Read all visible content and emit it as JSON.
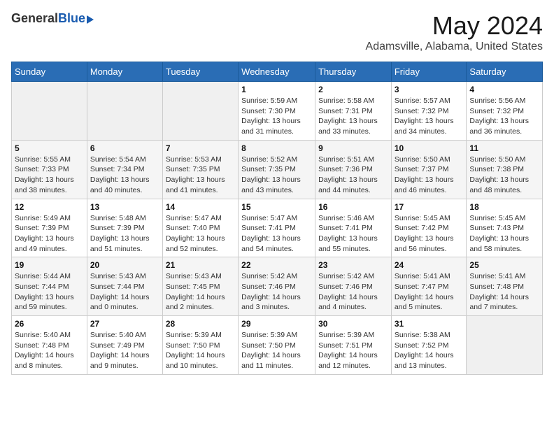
{
  "header": {
    "logo_general": "General",
    "logo_blue": "Blue",
    "title": "May 2024",
    "subtitle": "Adamsville, Alabama, United States"
  },
  "days_of_week": [
    "Sunday",
    "Monday",
    "Tuesday",
    "Wednesday",
    "Thursday",
    "Friday",
    "Saturday"
  ],
  "weeks": [
    {
      "days": [
        {
          "number": "",
          "info": ""
        },
        {
          "number": "",
          "info": ""
        },
        {
          "number": "",
          "info": ""
        },
        {
          "number": "1",
          "info": "Sunrise: 5:59 AM\nSunset: 7:30 PM\nDaylight: 13 hours and 31 minutes."
        },
        {
          "number": "2",
          "info": "Sunrise: 5:58 AM\nSunset: 7:31 PM\nDaylight: 13 hours and 33 minutes."
        },
        {
          "number": "3",
          "info": "Sunrise: 5:57 AM\nSunset: 7:32 PM\nDaylight: 13 hours and 34 minutes."
        },
        {
          "number": "4",
          "info": "Sunrise: 5:56 AM\nSunset: 7:32 PM\nDaylight: 13 hours and 36 minutes."
        }
      ]
    },
    {
      "days": [
        {
          "number": "5",
          "info": "Sunrise: 5:55 AM\nSunset: 7:33 PM\nDaylight: 13 hours and 38 minutes."
        },
        {
          "number": "6",
          "info": "Sunrise: 5:54 AM\nSunset: 7:34 PM\nDaylight: 13 hours and 40 minutes."
        },
        {
          "number": "7",
          "info": "Sunrise: 5:53 AM\nSunset: 7:35 PM\nDaylight: 13 hours and 41 minutes."
        },
        {
          "number": "8",
          "info": "Sunrise: 5:52 AM\nSunset: 7:35 PM\nDaylight: 13 hours and 43 minutes."
        },
        {
          "number": "9",
          "info": "Sunrise: 5:51 AM\nSunset: 7:36 PM\nDaylight: 13 hours and 44 minutes."
        },
        {
          "number": "10",
          "info": "Sunrise: 5:50 AM\nSunset: 7:37 PM\nDaylight: 13 hours and 46 minutes."
        },
        {
          "number": "11",
          "info": "Sunrise: 5:50 AM\nSunset: 7:38 PM\nDaylight: 13 hours and 48 minutes."
        }
      ]
    },
    {
      "days": [
        {
          "number": "12",
          "info": "Sunrise: 5:49 AM\nSunset: 7:39 PM\nDaylight: 13 hours and 49 minutes."
        },
        {
          "number": "13",
          "info": "Sunrise: 5:48 AM\nSunset: 7:39 PM\nDaylight: 13 hours and 51 minutes."
        },
        {
          "number": "14",
          "info": "Sunrise: 5:47 AM\nSunset: 7:40 PM\nDaylight: 13 hours and 52 minutes."
        },
        {
          "number": "15",
          "info": "Sunrise: 5:47 AM\nSunset: 7:41 PM\nDaylight: 13 hours and 54 minutes."
        },
        {
          "number": "16",
          "info": "Sunrise: 5:46 AM\nSunset: 7:41 PM\nDaylight: 13 hours and 55 minutes."
        },
        {
          "number": "17",
          "info": "Sunrise: 5:45 AM\nSunset: 7:42 PM\nDaylight: 13 hours and 56 minutes."
        },
        {
          "number": "18",
          "info": "Sunrise: 5:45 AM\nSunset: 7:43 PM\nDaylight: 13 hours and 58 minutes."
        }
      ]
    },
    {
      "days": [
        {
          "number": "19",
          "info": "Sunrise: 5:44 AM\nSunset: 7:44 PM\nDaylight: 13 hours and 59 minutes."
        },
        {
          "number": "20",
          "info": "Sunrise: 5:43 AM\nSunset: 7:44 PM\nDaylight: 14 hours and 0 minutes."
        },
        {
          "number": "21",
          "info": "Sunrise: 5:43 AM\nSunset: 7:45 PM\nDaylight: 14 hours and 2 minutes."
        },
        {
          "number": "22",
          "info": "Sunrise: 5:42 AM\nSunset: 7:46 PM\nDaylight: 14 hours and 3 minutes."
        },
        {
          "number": "23",
          "info": "Sunrise: 5:42 AM\nSunset: 7:46 PM\nDaylight: 14 hours and 4 minutes."
        },
        {
          "number": "24",
          "info": "Sunrise: 5:41 AM\nSunset: 7:47 PM\nDaylight: 14 hours and 5 minutes."
        },
        {
          "number": "25",
          "info": "Sunrise: 5:41 AM\nSunset: 7:48 PM\nDaylight: 14 hours and 7 minutes."
        }
      ]
    },
    {
      "days": [
        {
          "number": "26",
          "info": "Sunrise: 5:40 AM\nSunset: 7:48 PM\nDaylight: 14 hours and 8 minutes."
        },
        {
          "number": "27",
          "info": "Sunrise: 5:40 AM\nSunset: 7:49 PM\nDaylight: 14 hours and 9 minutes."
        },
        {
          "number": "28",
          "info": "Sunrise: 5:39 AM\nSunset: 7:50 PM\nDaylight: 14 hours and 10 minutes."
        },
        {
          "number": "29",
          "info": "Sunrise: 5:39 AM\nSunset: 7:50 PM\nDaylight: 14 hours and 11 minutes."
        },
        {
          "number": "30",
          "info": "Sunrise: 5:39 AM\nSunset: 7:51 PM\nDaylight: 14 hours and 12 minutes."
        },
        {
          "number": "31",
          "info": "Sunrise: 5:38 AM\nSunset: 7:52 PM\nDaylight: 14 hours and 13 minutes."
        },
        {
          "number": "",
          "info": ""
        }
      ]
    }
  ]
}
